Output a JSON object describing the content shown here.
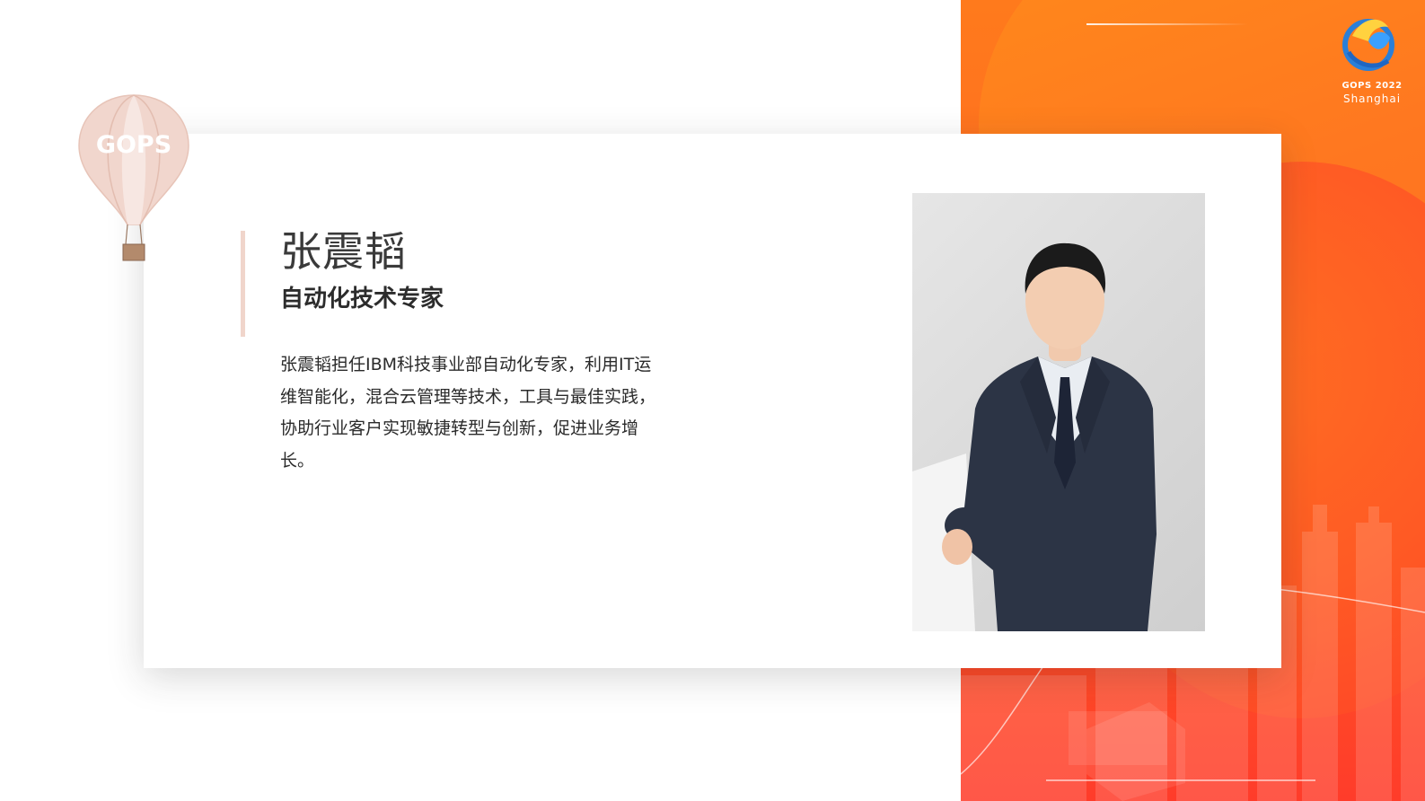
{
  "speaker": {
    "name": "张震韬",
    "title": "自动化技术专家",
    "bio": "张震韬担任IBM科技事业部自动化专家，利用IT运维智能化，混合云管理等技术，工具与最佳实践，协助行业客户实现敏捷转型与创新，促进业务增长。"
  },
  "balloon": {
    "label": "GOPS"
  },
  "event_logo": {
    "line1": "GOPS 2022",
    "line2": "Shanghai"
  },
  "colors": {
    "accent_orange": "#ff6a22",
    "accent_red": "#ff3c2a",
    "accent_bar": "#f0d5cb",
    "text_dark": "#2a2a2a"
  }
}
